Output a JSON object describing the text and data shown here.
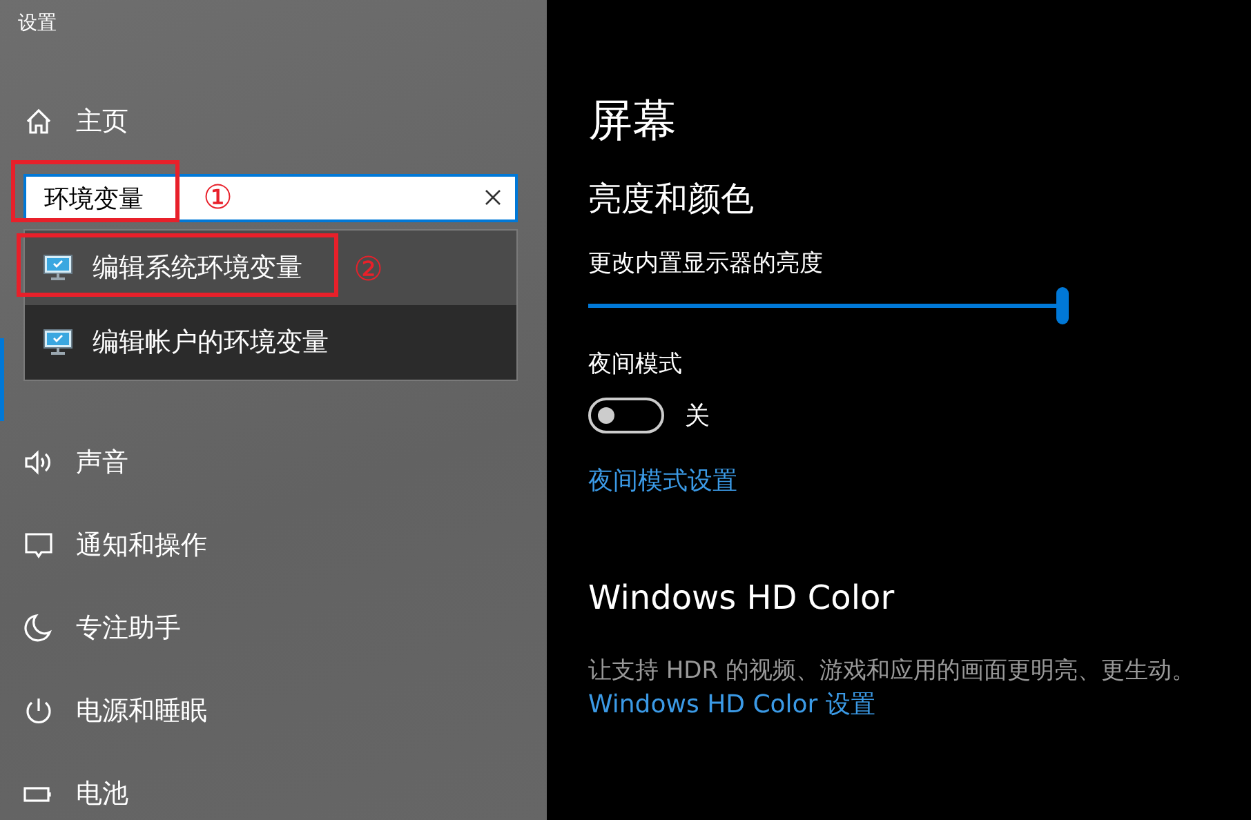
{
  "window": {
    "title": "设置"
  },
  "sidebar": {
    "home": {
      "label": "主页"
    },
    "search": {
      "value": "环境变量",
      "suggestions": [
        {
          "label": "编辑系统环境变量",
          "selected": true
        },
        {
          "label": "编辑帐户的环境变量",
          "selected": false
        }
      ]
    },
    "items": [
      {
        "selected": true
      },
      {
        "label": "声音",
        "selected": false
      },
      {
        "label": "通知和操作",
        "selected": false
      },
      {
        "label": "专注助手",
        "selected": false
      },
      {
        "label": "电源和睡眠",
        "selected": false
      },
      {
        "label": "电池",
        "selected": false
      }
    ]
  },
  "annotations": [
    {
      "label": "①"
    },
    {
      "label": "②"
    }
  ],
  "content": {
    "title": "屏幕",
    "section": "亮度和颜色",
    "brightness": {
      "label": "更改内置显示器的亮度",
      "level": 1
    },
    "night_mode": {
      "label": "夜间模式",
      "on": false,
      "state_text": "关"
    },
    "night_link": "夜间模式设置",
    "hd_title": "Windows HD Color",
    "hd_text": "让支持 HDR 的视频、游戏和应用的画面更明亮、更生动。",
    "hd_link": "Windows HD Color 设置"
  }
}
